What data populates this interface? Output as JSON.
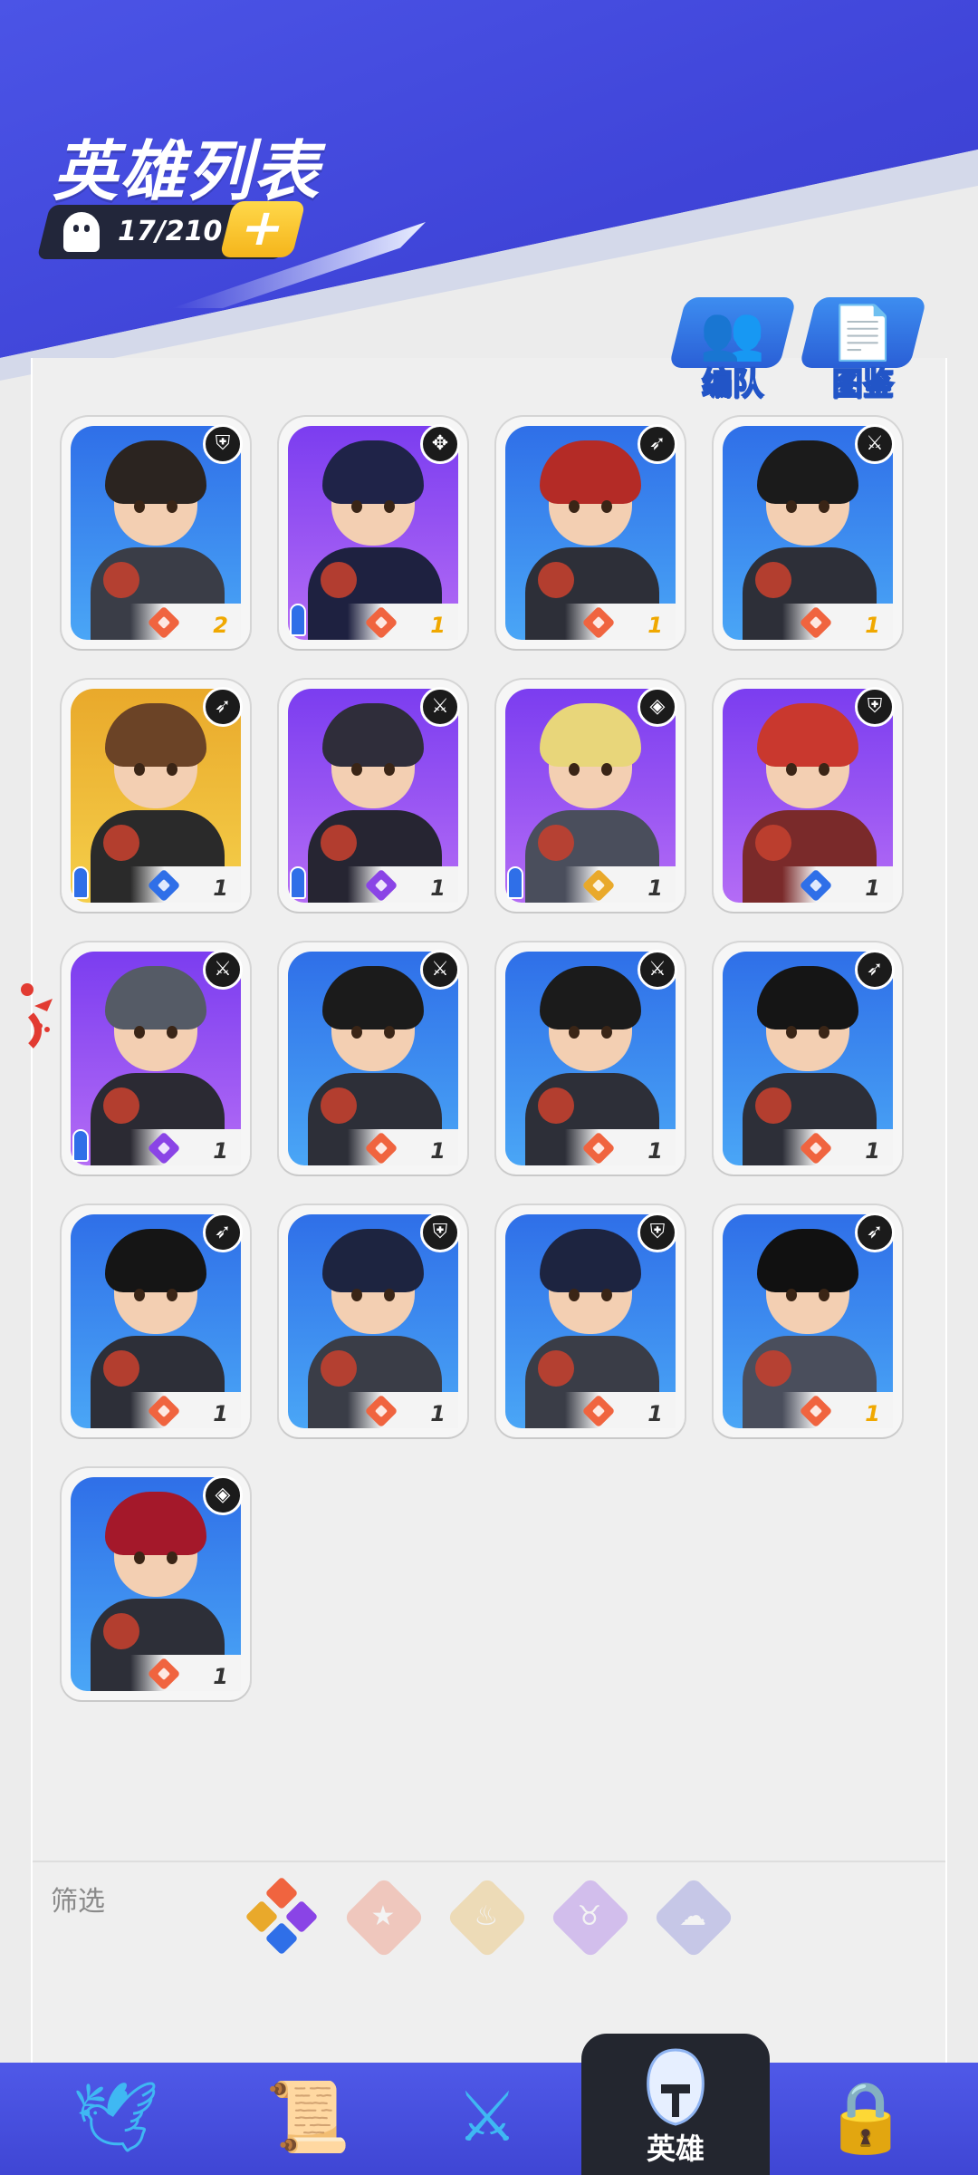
{
  "header": {
    "title": "英雄列表",
    "capacity": "17/210",
    "add_symbol": "+"
  },
  "top_buttons": [
    {
      "label": "编队",
      "icon": "team-icon",
      "glyph": "👥"
    },
    {
      "label": "图鉴",
      "icon": "codex-icon",
      "glyph": "📄"
    }
  ],
  "colors": {
    "header_blue": "#4b54e6",
    "element_fire": "#f0643f",
    "element_shadow": "#8a44e6",
    "element_water": "#2f6fe8",
    "element_light": "#e9a92b",
    "rarity_blue": "#4f9cf6",
    "rarity_purple": "#9b55f0",
    "rarity_gold": "#f2c63a"
  },
  "heroes": [
    {
      "level": "2",
      "level_gold": true,
      "frame": "blue",
      "element": "fire",
      "role": "shield-icon",
      "role_glyph": "⛨",
      "person": false,
      "hair": "#2b2420",
      "body": "#3a3d47"
    },
    {
      "level": "1",
      "level_gold": true,
      "frame": "purple",
      "element": "fire",
      "role": "cross-icon",
      "role_glyph": "✥",
      "person": true,
      "hair": "#1f2348",
      "body": "#1e2140"
    },
    {
      "level": "1",
      "level_gold": true,
      "frame": "blue",
      "element": "fire",
      "role": "bow-icon",
      "role_glyph": "➶",
      "person": false,
      "hair": "#b42b26",
      "body": "#2d2f38"
    },
    {
      "level": "1",
      "level_gold": true,
      "frame": "blue",
      "element": "fire",
      "role": "sword-icon",
      "role_glyph": "⚔",
      "person": false,
      "hair": "#1b1b1b",
      "body": "#2d2f38"
    },
    {
      "level": "1",
      "level_gold": false,
      "frame": "gold",
      "element": "water",
      "role": "bow-icon",
      "role_glyph": "➶",
      "person": true,
      "hair": "#6b4326",
      "body": "#2a2a2a"
    },
    {
      "level": "1",
      "level_gold": false,
      "frame": "purple",
      "element": "shadow",
      "role": "sword-icon",
      "role_glyph": "⚔",
      "person": true,
      "hair": "#2f2d3a",
      "body": "#262532"
    },
    {
      "level": "1",
      "level_gold": false,
      "frame": "purple",
      "element": "light",
      "role": "spiral-icon",
      "role_glyph": "◈",
      "person": true,
      "hair": "#e8d67a",
      "body": "#4a4e5c"
    },
    {
      "level": "1",
      "level_gold": false,
      "frame": "purple",
      "element": "water",
      "role": "shield-icon",
      "role_glyph": "⛨",
      "person": false,
      "hair": "#c9382e",
      "body": "#7a2a2a"
    },
    {
      "level": "1",
      "level_gold": false,
      "frame": "purple",
      "element": "shadow",
      "role": "sword-icon",
      "role_glyph": "⚔",
      "person": true,
      "hair": "#555b66",
      "body": "#2b2a33"
    },
    {
      "level": "1",
      "level_gold": false,
      "frame": "blue",
      "element": "fire",
      "role": "sword-icon",
      "role_glyph": "⚔",
      "person": false,
      "hair": "#1b1b1b",
      "body": "#2d2f38"
    },
    {
      "level": "1",
      "level_gold": false,
      "frame": "blue",
      "element": "fire",
      "role": "sword-icon",
      "role_glyph": "⚔",
      "person": false,
      "hair": "#1b1b1b",
      "body": "#2d2f38"
    },
    {
      "level": "1",
      "level_gold": false,
      "frame": "blue",
      "element": "fire",
      "role": "bow-icon",
      "role_glyph": "➶",
      "person": false,
      "hair": "#151515",
      "body": "#2d2f38"
    },
    {
      "level": "1",
      "level_gold": false,
      "frame": "blue",
      "element": "fire",
      "role": "bow-icon",
      "role_glyph": "➶",
      "person": false,
      "hair": "#151515",
      "body": "#2d2f38"
    },
    {
      "level": "1",
      "level_gold": false,
      "frame": "blue",
      "element": "fire",
      "role": "shield-icon",
      "role_glyph": "⛨",
      "person": false,
      "hair": "#1d2440",
      "body": "#3a3d47"
    },
    {
      "level": "1",
      "level_gold": false,
      "frame": "blue",
      "element": "fire",
      "role": "shield-icon",
      "role_glyph": "⛨",
      "person": false,
      "hair": "#1d2440",
      "body": "#3a3d47"
    },
    {
      "level": "1",
      "level_gold": true,
      "frame": "blue",
      "element": "fire",
      "role": "bow-icon",
      "role_glyph": "➶",
      "person": false,
      "hair": "#111111",
      "body": "#4a4e5c"
    },
    {
      "level": "1",
      "level_gold": false,
      "frame": "blue",
      "element": "fire",
      "role": "spiral-icon",
      "role_glyph": "◈",
      "person": false,
      "hair": "#a4182a",
      "body": "#2d2f38"
    }
  ],
  "filter": {
    "label": "筛选",
    "options": [
      {
        "name": "all",
        "icon": "all-elements-icon",
        "active": true
      },
      {
        "name": "fire",
        "icon": "star-icon",
        "active": false
      },
      {
        "name": "light",
        "icon": "flame-icon",
        "active": false
      },
      {
        "name": "shadow",
        "icon": "horns-icon",
        "active": false
      },
      {
        "name": "water",
        "icon": "cloud-icon",
        "active": false
      }
    ]
  },
  "nav": {
    "items": [
      {
        "icon": "wings-icon",
        "glyph": "🕊"
      },
      {
        "icon": "scroll-icon",
        "glyph": "📜"
      },
      {
        "icon": "crossed-swords-icon",
        "glyph": "⚔"
      },
      {
        "icon": "lock-icon",
        "glyph": "🔒"
      }
    ],
    "active_label": "英雄"
  }
}
